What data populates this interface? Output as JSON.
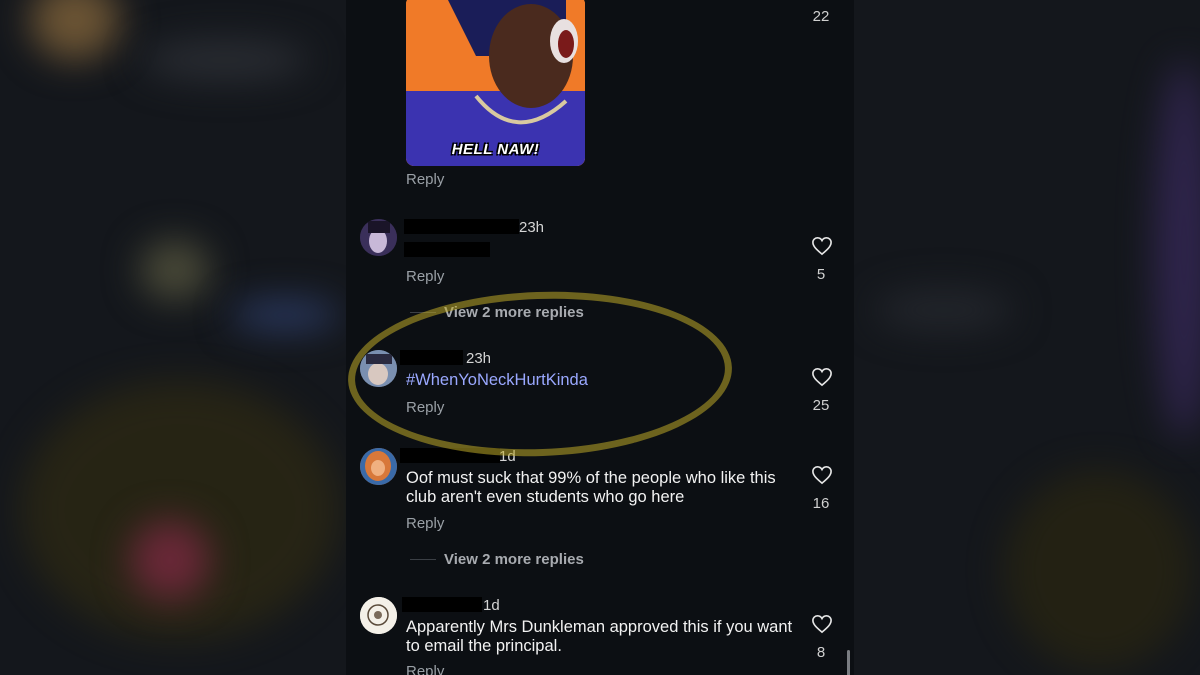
{
  "gif": {
    "caption": "HELL NAW!"
  },
  "top_comment": {
    "like_count": "22",
    "reply_label": "Reply"
  },
  "comments": [
    {
      "time": "23h",
      "body": "",
      "reply_label": "Reply",
      "like_count": "5"
    },
    {
      "time": "23h",
      "body": "#WhenYoNeckHurtKinda",
      "reply_label": "Reply",
      "like_count": "25"
    },
    {
      "time": "1d",
      "body": "Oof must suck that 99% of the people who like this club aren't even students who go here",
      "reply_label": "Reply",
      "like_count": "16"
    },
    {
      "time": "1d",
      "body": "Apparently Mrs Dunkleman approved this if you want to email the principal.",
      "reply_label": "Reply",
      "like_count": "8"
    }
  ],
  "view_more_replies": [
    "View 2 more replies",
    "View 2 more replies"
  ],
  "colors": {
    "background": "#0c0f13",
    "hashtag": "#9aa8ff",
    "highlight": "#bfa928"
  }
}
